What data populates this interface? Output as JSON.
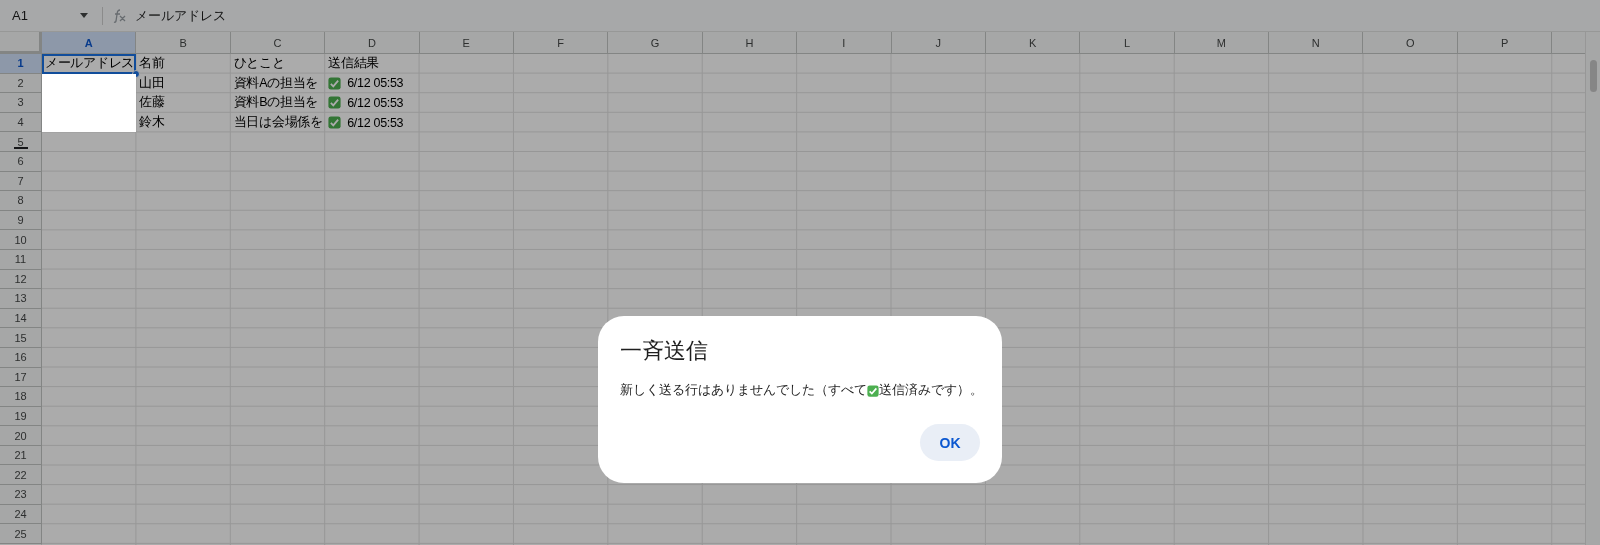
{
  "name_box": {
    "value": "A1"
  },
  "formula_bar": {
    "value": "メールアドレス"
  },
  "columns": [
    {
      "label": "A",
      "selected": true
    },
    {
      "label": "B",
      "selected": false
    },
    {
      "label": "C",
      "selected": false
    },
    {
      "label": "D",
      "selected": false
    },
    {
      "label": "E",
      "selected": false
    },
    {
      "label": "F",
      "selected": false
    },
    {
      "label": "G",
      "selected": false
    },
    {
      "label": "H",
      "selected": false
    },
    {
      "label": "I",
      "selected": false
    },
    {
      "label": "J",
      "selected": false
    },
    {
      "label": "K",
      "selected": false
    },
    {
      "label": "L",
      "selected": false
    },
    {
      "label": "M",
      "selected": false
    },
    {
      "label": "N",
      "selected": false
    },
    {
      "label": "O",
      "selected": false
    },
    {
      "label": "P",
      "selected": false
    }
  ],
  "rows": [
    {
      "label": "1",
      "selected": true,
      "cells": [
        {
          "kind": "text",
          "text": "メールアドレス"
        },
        {
          "kind": "text",
          "text": "名前"
        },
        {
          "kind": "text",
          "text": "ひとこと"
        },
        {
          "kind": "text",
          "text": "送信結果"
        }
      ]
    },
    {
      "label": "2",
      "selected": false,
      "cells": [
        {
          "kind": "redacted"
        },
        {
          "kind": "text",
          "text": "山田"
        },
        {
          "kind": "text",
          "text": "資料Aの担当を"
        },
        {
          "kind": "status",
          "sent": true,
          "text": "6/12 05:53"
        }
      ]
    },
    {
      "label": "3",
      "selected": false,
      "cells": [
        {
          "kind": "redacted"
        },
        {
          "kind": "text",
          "text": "佐藤"
        },
        {
          "kind": "text",
          "text": "資料Bの担当を"
        },
        {
          "kind": "status",
          "sent": true,
          "text": "6/12 05:53"
        }
      ]
    },
    {
      "label": "4",
      "selected": false,
      "cells": [
        {
          "kind": "redacted"
        },
        {
          "kind": "text",
          "text": "鈴木"
        },
        {
          "kind": "text",
          "text": "当日は会場係を"
        },
        {
          "kind": "status",
          "sent": true,
          "text": "6/12 05:53"
        }
      ]
    },
    {
      "label": "5",
      "selected": false,
      "resize_handle": true
    },
    {
      "label": "6",
      "selected": false
    },
    {
      "label": "7",
      "selected": false
    },
    {
      "label": "8",
      "selected": false
    },
    {
      "label": "9",
      "selected": false
    },
    {
      "label": "10",
      "selected": false
    },
    {
      "label": "11",
      "selected": false
    },
    {
      "label": "12",
      "selected": false
    },
    {
      "label": "13",
      "selected": false
    },
    {
      "label": "14",
      "selected": false
    },
    {
      "label": "15",
      "selected": false
    },
    {
      "label": "16",
      "selected": false
    },
    {
      "label": "17",
      "selected": false
    },
    {
      "label": "18",
      "selected": false
    },
    {
      "label": "19",
      "selected": false
    },
    {
      "label": "20",
      "selected": false
    },
    {
      "label": "21",
      "selected": false
    },
    {
      "label": "22",
      "selected": false
    },
    {
      "label": "23",
      "selected": false
    },
    {
      "label": "24",
      "selected": false
    },
    {
      "label": "25",
      "selected": false
    }
  ],
  "dialog": {
    "title": "一斉送信",
    "message_before": "新しく送る行はありませんでした（すべて",
    "message_after": "送信済みです）。",
    "button": "OK"
  }
}
